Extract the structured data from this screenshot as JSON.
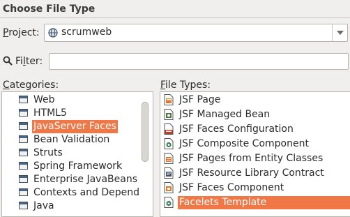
{
  "dialog": {
    "title": "Choose File Type"
  },
  "project": {
    "label_prefix": "P",
    "label_rest": "roject:",
    "value": "scrumweb"
  },
  "filter": {
    "label_prefix": "Fi",
    "label_underlined": "l",
    "label_rest": "ter:",
    "value": ""
  },
  "categories": {
    "label_underlined": "C",
    "label_rest": "ategories:",
    "items": [
      {
        "label": "Web",
        "selected": false
      },
      {
        "label": "HTML5",
        "selected": false
      },
      {
        "label": "JavaServer Faces",
        "selected": true
      },
      {
        "label": "Bean Validation",
        "selected": false
      },
      {
        "label": "Struts",
        "selected": false
      },
      {
        "label": "Spring Framework",
        "selected": false
      },
      {
        "label": "Enterprise JavaBeans",
        "selected": false
      },
      {
        "label": "Contexts and Depend",
        "selected": false
      },
      {
        "label": "Java",
        "selected": false
      }
    ]
  },
  "file_types": {
    "label_underlined": "F",
    "label_rest": "ile Types:",
    "items": [
      {
        "label": "JSF Page",
        "icon": "jsf-page-icon",
        "selected": false
      },
      {
        "label": "JSF Managed Bean",
        "icon": "managed-bean-icon",
        "selected": false
      },
      {
        "label": "JSF Faces Configuration",
        "icon": "faces-config-icon",
        "selected": false
      },
      {
        "label": "JSF Composite Component",
        "icon": "composite-component-icon",
        "selected": false
      },
      {
        "label": "JSF Pages from Entity Classes",
        "icon": "entity-pages-icon",
        "selected": false
      },
      {
        "label": "JSF Resource Library Contract",
        "icon": "resource-contract-icon",
        "selected": false
      },
      {
        "label": "JSF Faces Component",
        "icon": "faces-component-icon",
        "selected": false
      },
      {
        "label": "Facelets Template",
        "icon": "facelets-template-icon",
        "selected": true
      }
    ]
  },
  "colors": {
    "selection": "#f07746",
    "background": "#f0efed",
    "folder": "#4a6584"
  }
}
